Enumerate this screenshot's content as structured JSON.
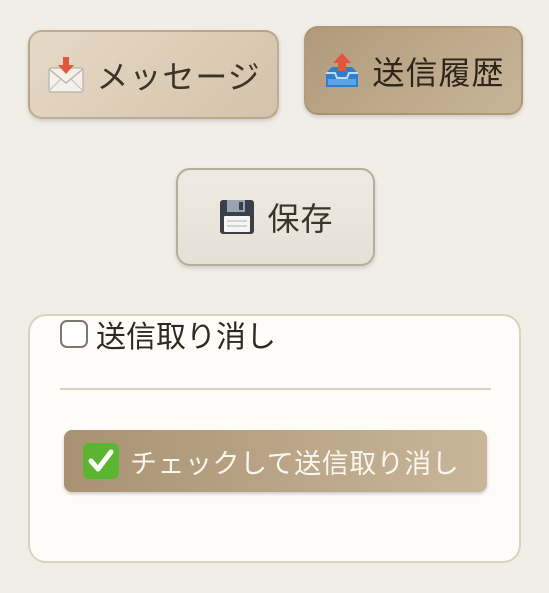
{
  "buttons": {
    "message": {
      "label": "メッセージ",
      "icon": "envelope-arrow-icon"
    },
    "history": {
      "label": "送信履歴",
      "icon": "outbox-tray-icon"
    },
    "save": {
      "label": "保存",
      "icon": "floppy-disk-icon"
    }
  },
  "panel": {
    "checkbox_label": "送信取り消し",
    "checkbox_checked": false,
    "confirm_button": {
      "label": "チェックして送信取り消し",
      "icon": "check-mark-button-icon"
    }
  },
  "colors": {
    "background": "#f1eee8",
    "button_light": "#d4c3aa",
    "button_dark": "#b19a7c",
    "confirm_button": "#a89272",
    "check_green": "#5cb531"
  }
}
